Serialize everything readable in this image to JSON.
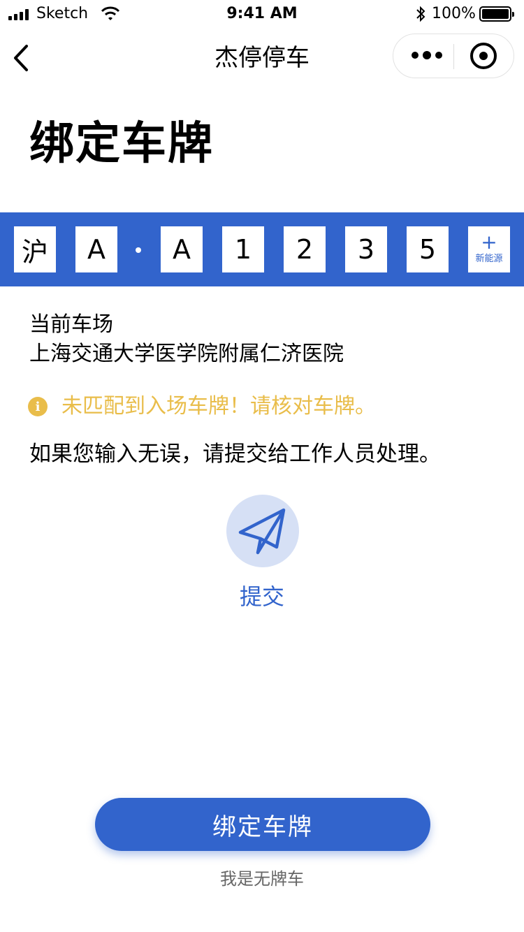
{
  "status_bar": {
    "carrier": "Sketch",
    "time": "9:41 AM",
    "battery_percent": "100%",
    "icons": [
      "signal-icon",
      "wifi-icon",
      "bluetooth-icon",
      "battery-icon"
    ]
  },
  "nav": {
    "title": "杰停停车",
    "back_icon": "chevron-left-icon",
    "more_icon": "more-dots-icon",
    "close_icon": "target-circle-icon"
  },
  "page": {
    "title": "绑定车牌"
  },
  "plate": {
    "province": "沪",
    "chars": [
      "A",
      "A",
      "1",
      "2",
      "3",
      "5"
    ],
    "new_energy_plus": "+",
    "new_energy_label": "新能源"
  },
  "lot": {
    "label": "当前车场",
    "name": "上海交通大学医学院附属仁济医院"
  },
  "warning": {
    "icon_char": "i",
    "text": "未匹配到入场车牌！请核对车牌。"
  },
  "hint": "如果您输入无误，请提交给工作人员处理。",
  "submit": {
    "label": "提交",
    "icon": "paper-plane-icon"
  },
  "bind_button": "绑定车牌",
  "no_plate_link": "我是无牌车",
  "colors": {
    "primary": "#3264cc",
    "warning": "#e9bd4a",
    "submit_bg": "#d6e0f5"
  }
}
